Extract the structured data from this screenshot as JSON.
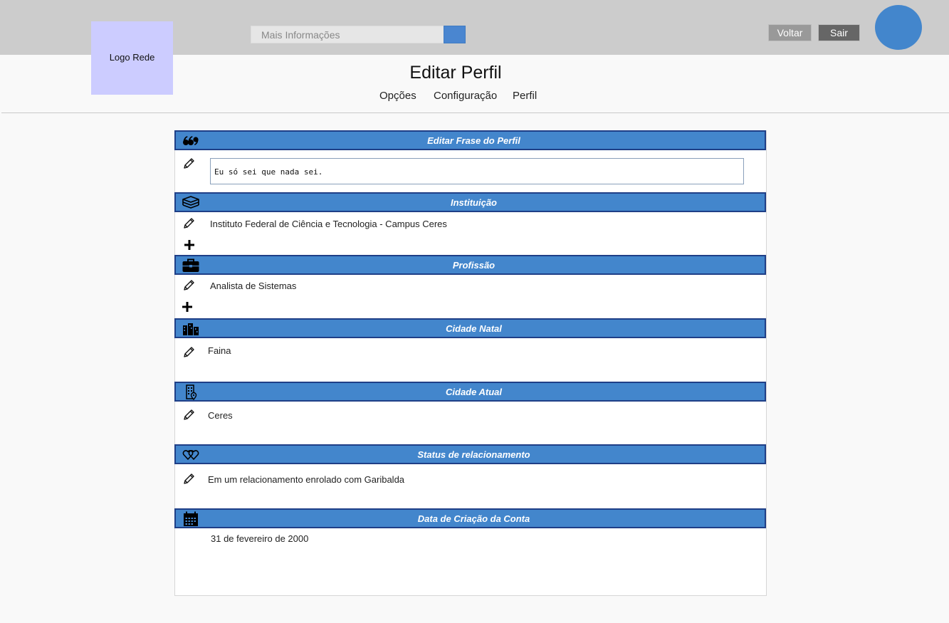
{
  "header": {
    "logo_label": "Logo Rede",
    "search_placeholder": "Mais Informações",
    "back_label": "Voltar",
    "exit_label": "Sair"
  },
  "page": {
    "title": "Editar Perfil",
    "nav": [
      "Opções",
      "Configuração",
      "Perfil"
    ]
  },
  "sections": {
    "phrase": {
      "title": "Editar Frase do Perfil",
      "value": "Eu só sei que nada sei.",
      "icon": "quote-icon"
    },
    "institution": {
      "title": "Instituição",
      "value": "Instituto Federal de Ciência e Tecnologia - Campus Ceres",
      "icon": "books-icon"
    },
    "profession": {
      "title": "Profissão",
      "value": "Analista de Sistemas",
      "icon": "briefcase-icon"
    },
    "hometown": {
      "title": "Cidade Natal",
      "value": "Faina",
      "icon": "city-icon"
    },
    "current_city": {
      "title": "Cidade Atual",
      "value": "Ceres",
      "icon": "building-location-icon"
    },
    "relationship": {
      "title": "Status de relacionamento",
      "value": "Em um relacionamento enrolado com Garibalda",
      "icon": "hearts-icon"
    },
    "created": {
      "title": "Data de Criação da Conta",
      "value": "31 de fevereiro de 2000",
      "icon": "calendar-icon"
    }
  },
  "colors": {
    "header_bar": "#cccccc",
    "section_head": "#4386cc",
    "section_border": "#1f3f87",
    "logo_bg": "#ccccff",
    "avatar": "#4386cc"
  }
}
